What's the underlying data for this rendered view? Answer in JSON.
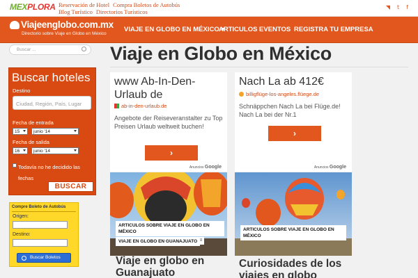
{
  "topbar": {
    "logo": {
      "part_a": "MEX",
      "part_b": "PLORA"
    },
    "links": [
      "Reservación de Hotel",
      "Compra Boletos de Autobús",
      "Blog Turístico",
      "Directorios Turísticos"
    ],
    "social_icons": [
      "rss-icon",
      "twitter-icon",
      "facebook-icon"
    ],
    "social_glyphs": [
      "◥",
      "t",
      "f"
    ]
  },
  "header": {
    "site_name": "Viajeenglobo.com.mx",
    "tagline": "Directorio sobre Viaje en Globo en México",
    "nav": [
      "VIAJE EN GLOBO EN MÉXICO",
      "ARTICULOS",
      "EVENTOS",
      "REGISTRA TU EMPRESA"
    ],
    "nav_caret": "▾"
  },
  "sidebar": {
    "search_placeholder": "Buscar ...",
    "hotels": {
      "title": "Buscar hoteles",
      "destino_label": "Destino",
      "destino_placeholder": "Ciudad, Región, País, Lugar",
      "entrada_label": "Fecha de entrada",
      "entrada_day": "15",
      "entrada_month": "junio '14",
      "salida_label": "Fecha de salida",
      "salida_day": "16",
      "salida_month": "junio '14",
      "undecided": "Todavía no he decidido las fechas",
      "button": "BUSCAR"
    },
    "bus": {
      "title": "Compre Boleto de Autobús",
      "origen": "Origen:",
      "destino": "Destino:",
      "button": "Buscar Boletos"
    }
  },
  "main": {
    "page_title": "Viaje en Globo en México",
    "ads": [
      {
        "headline": "www Ab-In-Den-Urlaub de",
        "url": "ab-in-den-urlaub.de",
        "desc": "Angebote der Reiseveranstalter zu Top Preisen Urlaub weltweit buchen!",
        "arrow": "›",
        "ads_by": "Anuncios",
        "google": "Google"
      },
      {
        "headline": "Nach La ab 412€",
        "url": "billigflüge-los-angeles.flüege.de",
        "desc": "Schnäppchen Nach La bei Flüge.de! Nach La bei der Nr.1",
        "arrow": "›",
        "ads_by": "Anuncios",
        "google": "Google"
      }
    ],
    "cards": [
      {
        "category": "ARTICULOS SOBRE VIAJE EN GLOBO EN MÉXICO",
        "tag": "VIAJE EN GLOBO EN GUANAJUATO",
        "title": "Viaje en globo en Guanajuato"
      },
      {
        "category": "ARTICULOS SOBRE VIAJE EN GLOBO EN MÉXICO",
        "title": "Curiosidades de los viajes en globo"
      }
    ],
    "menu_glyph": "≡"
  },
  "colors": {
    "accent": "#e2571e",
    "sidebar_box": "#d84a12",
    "bus_box": "#ffd829",
    "bus_button": "#2c6ed5"
  }
}
